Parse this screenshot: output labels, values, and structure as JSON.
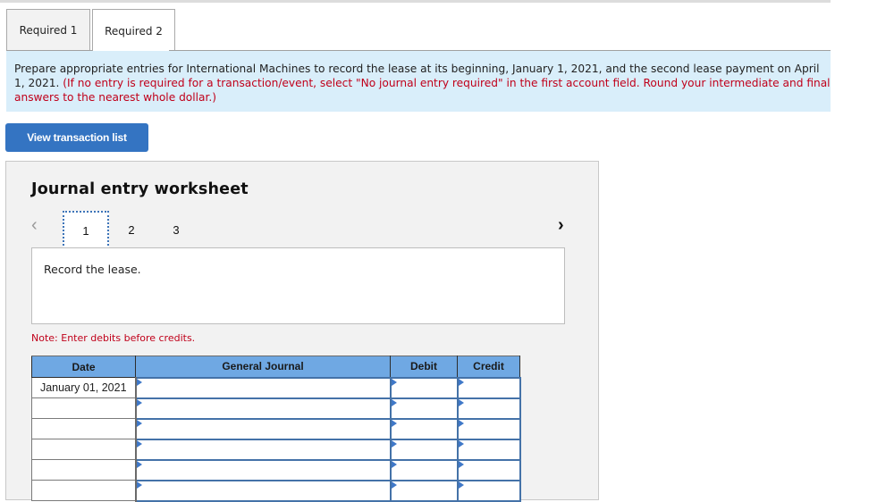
{
  "tabs": [
    {
      "label": "Required 1",
      "active": false
    },
    {
      "label": "Required 2",
      "active": true
    }
  ],
  "instructions": {
    "main": "Prepare appropriate entries for International Machines to record the lease at its beginning, January 1, 2021, and the second lease payment on April 1, 2021.",
    "note": "(If no entry is required for a transaction/event, select \"No journal entry required\" in the first account field. Round your intermediate and final answers to the nearest whole dollar.)"
  },
  "view_transaction_list_label": "View transaction list",
  "worksheet": {
    "title": "Journal entry worksheet",
    "prev_icon": "chevron-left-icon",
    "next_icon": "chevron-right-icon",
    "pages": [
      "1",
      "2",
      "3"
    ],
    "current_page": "1",
    "task_text": "Record the lease.",
    "note": "Note: Enter debits before credits.",
    "table": {
      "headers": {
        "date": "Date",
        "account": "General Journal",
        "debit": "Debit",
        "credit": "Credit"
      },
      "rows": [
        {
          "date": "January 01, 2021",
          "account": "",
          "debit": "",
          "credit": ""
        },
        {
          "date": "",
          "account": "",
          "debit": "",
          "credit": ""
        },
        {
          "date": "",
          "account": "",
          "debit": "",
          "credit": ""
        },
        {
          "date": "",
          "account": "",
          "debit": "",
          "credit": ""
        },
        {
          "date": "",
          "account": "",
          "debit": "",
          "credit": ""
        },
        {
          "date": "",
          "account": "",
          "debit": "",
          "credit": ""
        }
      ]
    }
  }
}
